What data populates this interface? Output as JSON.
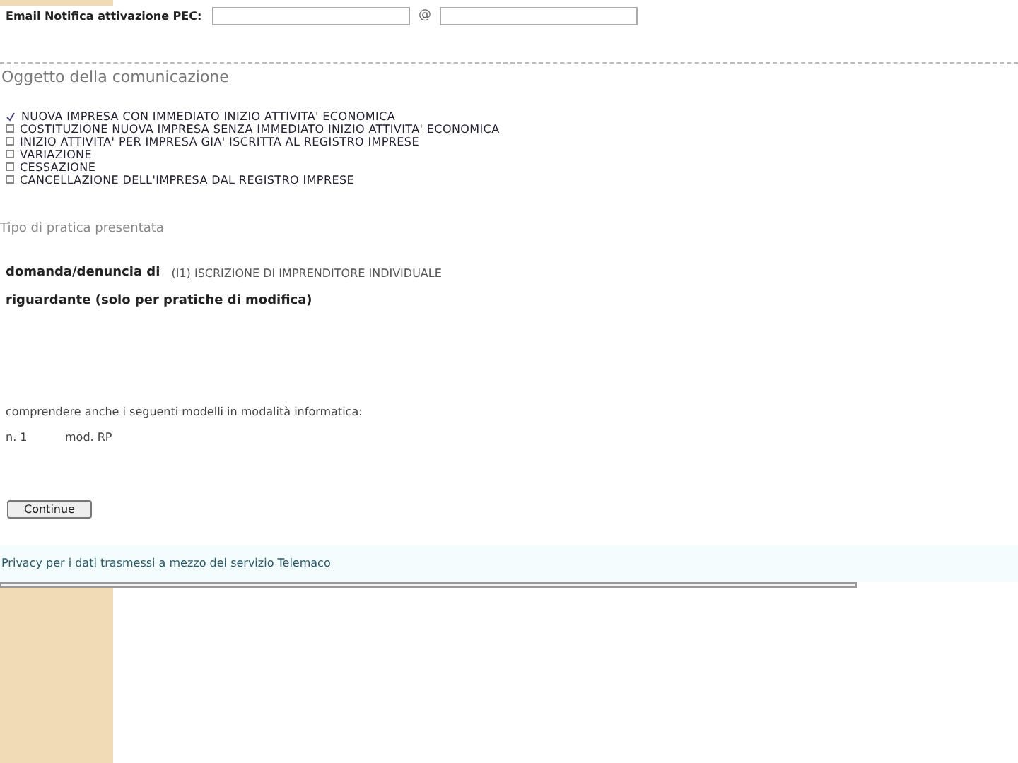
{
  "email_row": {
    "label": "Email Notifica attivazione PEC:",
    "separator": "@"
  },
  "oggetto": {
    "title": "Oggetto della comunicazione",
    "options": [
      {
        "label": "NUOVA IMPRESA CON IMMEDIATO INIZIO ATTIVITA' ECONOMICA",
        "checked": true
      },
      {
        "label": "COSTITUZIONE NUOVA IMPRESA SENZA IMMEDIATO INIZIO ATTIVITA' ECONOMICA",
        "checked": false
      },
      {
        "label": "INIZIO ATTIVITA' PER IMPRESA GIA' ISCRITTA AL REGISTRO IMPRESE",
        "checked": false
      },
      {
        "label": "VARIAZIONE",
        "checked": false
      },
      {
        "label": "CESSAZIONE",
        "checked": false
      },
      {
        "label": "CANCELLAZIONE DELL'IMPRESA DAL REGISTRO IMPRESE",
        "checked": false
      }
    ]
  },
  "tipo": {
    "title": "Tipo di pratica presentata",
    "domanda_label": "domanda/denuncia di",
    "domanda_value": "(I1) ISCRIZIONE DI IMPRENDITORE INDIVIDUALE",
    "riguardante_label": "riguardante (solo per pratiche di modifica)",
    "modelli_text": "comprendere anche i seguenti modelli in modalità informatica:",
    "modelli": [
      {
        "count": "n. 1",
        "name": "mod. RP"
      }
    ]
  },
  "continue_button": "Continue",
  "privacy_link": "Privacy per i dati trasmessi a mezzo del servizio Telemaco"
}
